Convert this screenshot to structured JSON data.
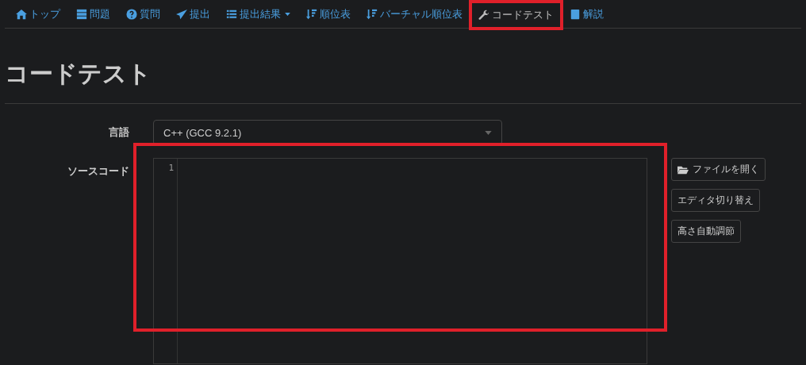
{
  "nav": [
    {
      "label": "トップ",
      "kind": "home",
      "selected": false,
      "highlighted": false
    },
    {
      "label": "問題",
      "kind": "tasks",
      "selected": false,
      "highlighted": false
    },
    {
      "label": "質問",
      "kind": "question",
      "selected": false,
      "highlighted": false
    },
    {
      "label": "提出",
      "kind": "send",
      "selected": false,
      "highlighted": false
    },
    {
      "label": "提出結果",
      "kind": "list",
      "selected": false,
      "highlighted": false,
      "dropdown": true
    },
    {
      "label": "順位表",
      "kind": "sort",
      "selected": false,
      "highlighted": false
    },
    {
      "label": "バーチャル順位表",
      "kind": "sort",
      "selected": false,
      "highlighted": false
    },
    {
      "label": "コードテスト",
      "kind": "wrench",
      "selected": true,
      "highlighted": true
    },
    {
      "label": "解説",
      "kind": "book",
      "selected": false,
      "highlighted": false
    }
  ],
  "page_title": "コードテスト",
  "language": {
    "label": "言語",
    "value": "C++ (GCC 9.2.1)"
  },
  "source": {
    "label": "ソースコード",
    "line_numbers": [
      "1"
    ],
    "highlighted": true
  },
  "buttons": [
    {
      "label": "ファイルを開く",
      "kind": "folder"
    },
    {
      "label": "エディタ切り替え",
      "kind": "plain"
    },
    {
      "label": "高さ自動調節",
      "kind": "plain"
    }
  ]
}
